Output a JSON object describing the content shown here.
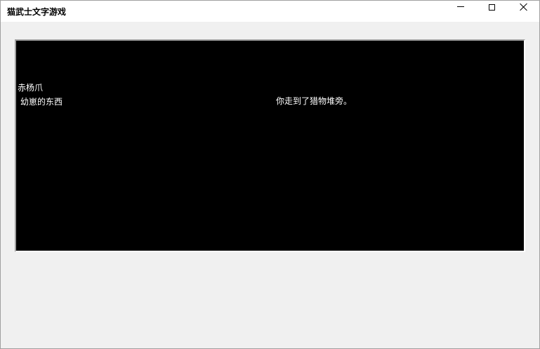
{
  "window": {
    "title": "猫武士文字游戏"
  },
  "game": {
    "location": "赤杨爪",
    "item": "幼崽的东西",
    "message": "你走到了猎物堆旁。"
  },
  "colors": {
    "titlebar_bg": "#ffffff",
    "window_bg": "#f0f0f0",
    "panel_bg": "#000000",
    "panel_text": "#ffffff"
  }
}
